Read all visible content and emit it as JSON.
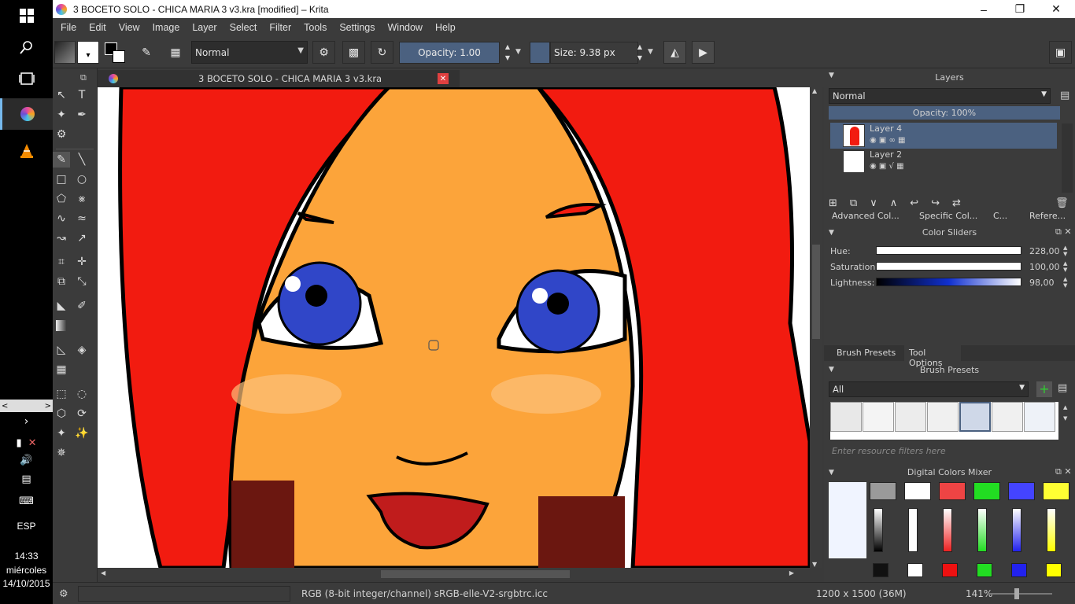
{
  "taskbar": {
    "language": "ESP",
    "time": "14:33",
    "day": "miércoles",
    "date": "14/10/2015"
  },
  "window": {
    "title": "3 BOCETO SOLO - CHICA MARIA 3 v3.kra [modified] – Krita"
  },
  "menu": [
    "File",
    "Edit",
    "View",
    "Image",
    "Layer",
    "Select",
    "Filter",
    "Tools",
    "Settings",
    "Window",
    "Help"
  ],
  "toolbar": {
    "blend_mode": "Normal",
    "opacity_label": "Opacity:  1.00",
    "size_label": "Size:  9.38 px"
  },
  "document_tab": {
    "name": "3 BOCETO SOLO - CHICA MARIA 3 v3.kra"
  },
  "layers": {
    "title": "Layers",
    "blend_mode": "Normal",
    "opacity_label": "Opacity:  100%",
    "items": [
      {
        "name": "Layer 4",
        "selected": true
      },
      {
        "name": "Layer 2",
        "selected": false
      }
    ]
  },
  "docker_tabs": [
    "Advanced Col...",
    "Specific Col...",
    "C...",
    "Refere..."
  ],
  "color_sliders": {
    "title": "Color Sliders",
    "hue_label": "Hue:",
    "hue_value": "228,00",
    "saturation_label": "Saturation:",
    "saturation_value": "100,00",
    "lightness_label": "Lightness:",
    "lightness_value": "98,00"
  },
  "brush_tabs": [
    "Brush Presets",
    "Tool Options"
  ],
  "brush_presets": {
    "title": "Brush Presets",
    "filter_value": "All",
    "search_placeholder": "Enter resource filters here"
  },
  "mixer": {
    "title": "Digital Colors Mixer",
    "swatches": [
      "#9a9a9a",
      "#ffffff",
      "#ee4444",
      "#22dd22",
      "#4444ff",
      "#ffff33"
    ],
    "bottom": [
      "#111111",
      "#ffffff",
      "#ee1111",
      "#22dd22",
      "#2222ee",
      "#ffff00"
    ]
  },
  "status": {
    "color_space": "RGB (8-bit integer/channel)  sRGB-elle-V2-srgbtrc.icc",
    "dimensions": "1200 x 1500 (36M)",
    "zoom": "141%"
  }
}
